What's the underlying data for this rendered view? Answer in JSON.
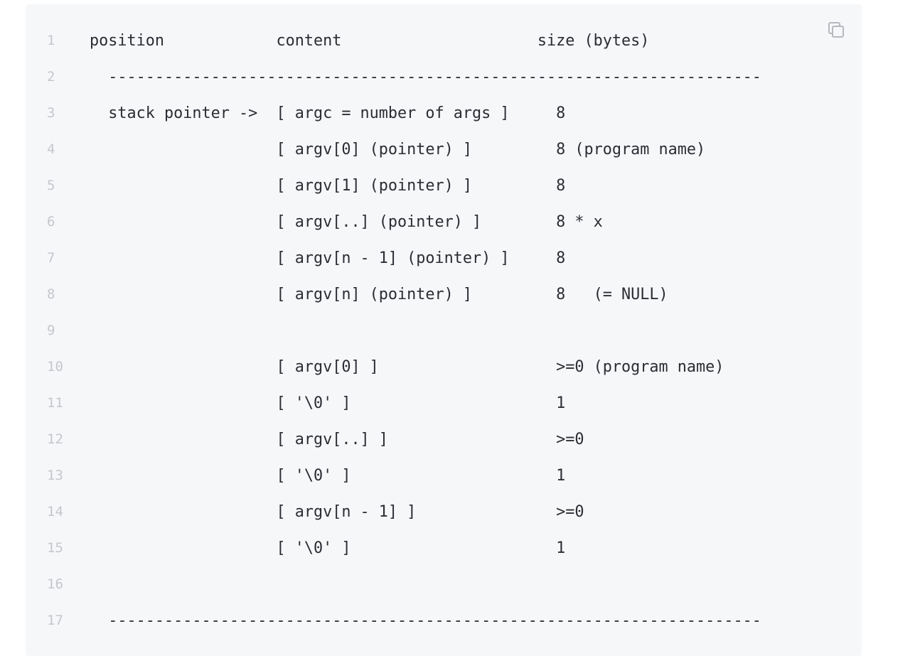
{
  "code": {
    "lines": [
      {
        "number": "1",
        "text": "position            content                     size (bytes)"
      },
      {
        "number": "2",
        "text": "  ----------------------------------------------------------------------"
      },
      {
        "number": "3",
        "text": "  stack pointer ->  [ argc = number of args ]     8"
      },
      {
        "number": "4",
        "text": "                    [ argv[0] (pointer) ]         8 (program name)"
      },
      {
        "number": "5",
        "text": "                    [ argv[1] (pointer) ]         8"
      },
      {
        "number": "6",
        "text": "                    [ argv[..] (pointer) ]        8 * x"
      },
      {
        "number": "7",
        "text": "                    [ argv[n - 1] (pointer) ]     8"
      },
      {
        "number": "8",
        "text": "                    [ argv[n] (pointer) ]         8   (= NULL)"
      },
      {
        "number": "9",
        "text": ""
      },
      {
        "number": "10",
        "text": "                    [ argv[0] ]                   >=0 (program name)"
      },
      {
        "number": "11",
        "text": "                    [ '\\0' ]                      1"
      },
      {
        "number": "12",
        "text": "                    [ argv[..] ]                  >=0"
      },
      {
        "number": "13",
        "text": "                    [ '\\0' ]                      1"
      },
      {
        "number": "14",
        "text": "                    [ argv[n - 1] ]               >=0"
      },
      {
        "number": "15",
        "text": "                    [ '\\0' ]                      1"
      },
      {
        "number": "16",
        "text": ""
      },
      {
        "number": "17",
        "text": "  ----------------------------------------------------------------------"
      }
    ]
  },
  "toolbar": {
    "copy_icon": "copy-icon"
  },
  "colors": {
    "background": "#f6f7f9",
    "line_number": "#c4c7cc",
    "code_text": "#2a2d33"
  }
}
